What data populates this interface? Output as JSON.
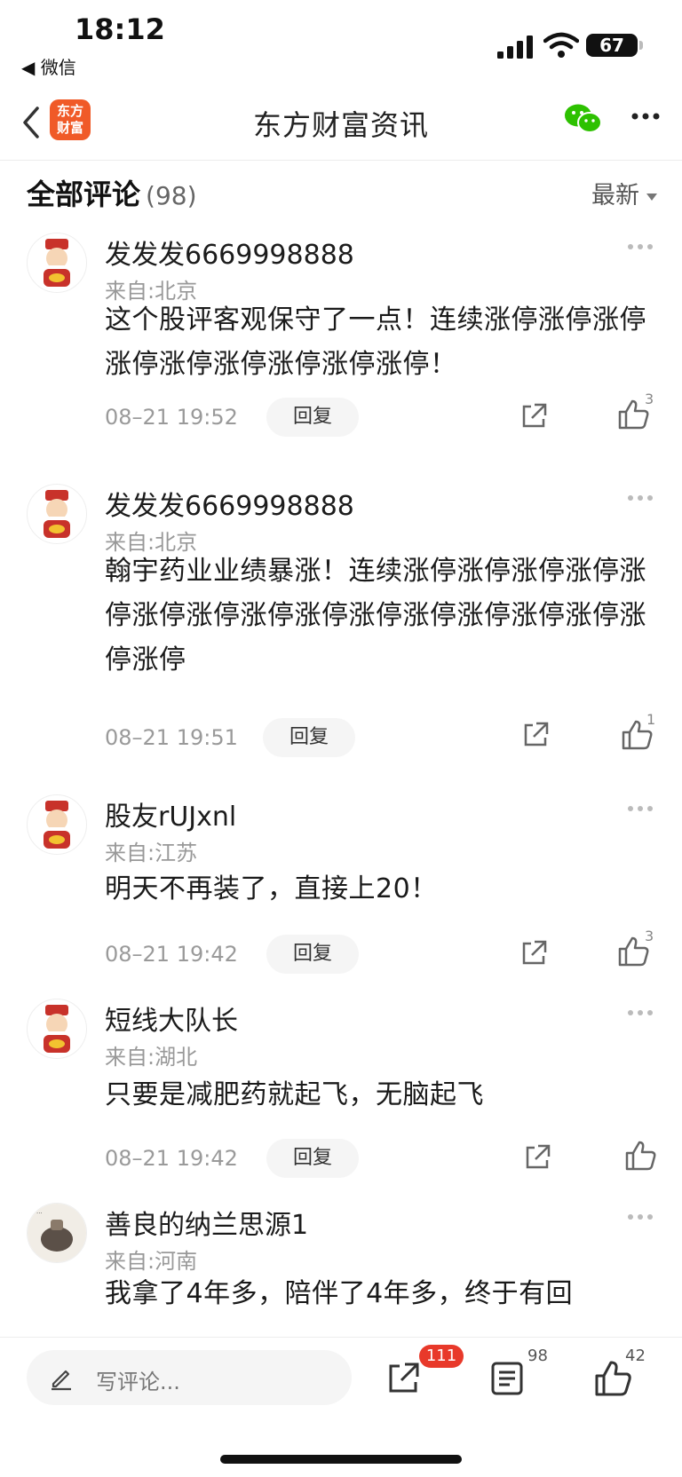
{
  "status": {
    "time": "18:12",
    "back_app": "◀ 微信",
    "battery": "67"
  },
  "nav": {
    "logo_line1": "东方",
    "logo_line2": "财富",
    "title": "东方财富资讯"
  },
  "section": {
    "title": "全部评论",
    "count": "(98)",
    "sort": "最新"
  },
  "comments": [
    {
      "user": "发发发6669998888",
      "location": "来自:北京",
      "text": "这个股评客观保守了一点！连续涨停涨停涨停涨停涨停涨停涨停涨停涨停！",
      "date": "08–21 19:52",
      "reply": "回复",
      "likes": "3"
    },
    {
      "user": "发发发6669998888",
      "location": "来自:北京",
      "text": "翰宇药业业绩暴涨！连续涨停涨停涨停涨停涨停涨停涨停涨停涨停涨停涨停涨停涨停涨停涨停涨停",
      "date": "08–21 19:51",
      "reply": "回复",
      "likes": "1"
    },
    {
      "user": "股友rUJxnl",
      "location": "来自:江苏",
      "text": "明天不再装了，直接上20！",
      "date": "08–21 19:42",
      "reply": "回复",
      "likes": "3"
    },
    {
      "user": "短线大队长",
      "location": "来自:湖北",
      "text": "只要是减肥药就起飞，无脑起飞",
      "date": "08–21 19:42",
      "reply": "回复",
      "likes": ""
    },
    {
      "user": "善良的纳兰思源1",
      "location": "来自:河南",
      "text": "我拿了4年多，陪伴了4年多，终于有回"
    }
  ],
  "bottom": {
    "placeholder": "写评论...",
    "share_badge": "111",
    "comment_count": "98",
    "like_count": "42"
  },
  "colors": {
    "brand": "#f05a28",
    "badge": "#e8392a",
    "wechat": "#2dc100"
  }
}
